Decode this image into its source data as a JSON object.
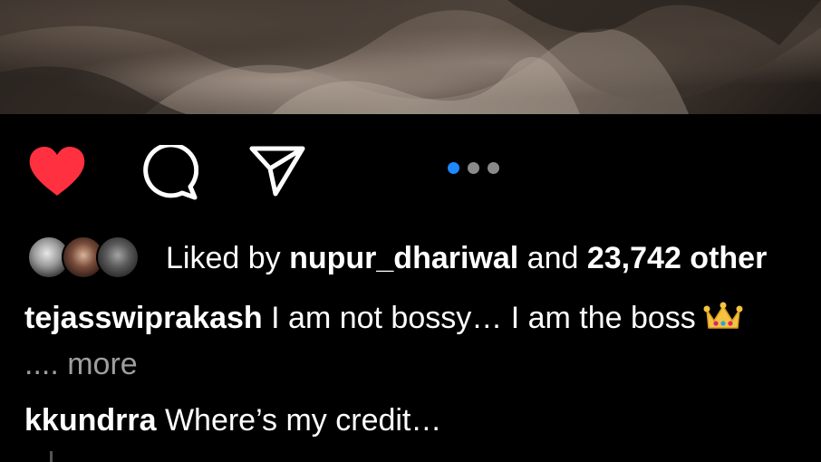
{
  "post": {
    "image_alt": "post photo",
    "carousel": {
      "total": 3,
      "active_index": 0
    }
  },
  "actions": {
    "like_icon": "heart-filled-icon",
    "comment_icon": "comment-bubble-icon",
    "share_icon": "paper-plane-icon",
    "liked": true,
    "like_color": "#ff3040",
    "carousel_active_color": "#1e88ff"
  },
  "likes": {
    "prefix": "Liked by ",
    "user": "nupur_dhariwal",
    "middle": " and ",
    "count": "23,742 other"
  },
  "caption": {
    "username": "tejasswiprakash",
    "text": " I am not bossy… I am the boss",
    "emoji": "crown-icon",
    "more": ".... more"
  },
  "comments": [
    {
      "username": "kkundrra",
      "text": " Where’s my credit…"
    }
  ]
}
